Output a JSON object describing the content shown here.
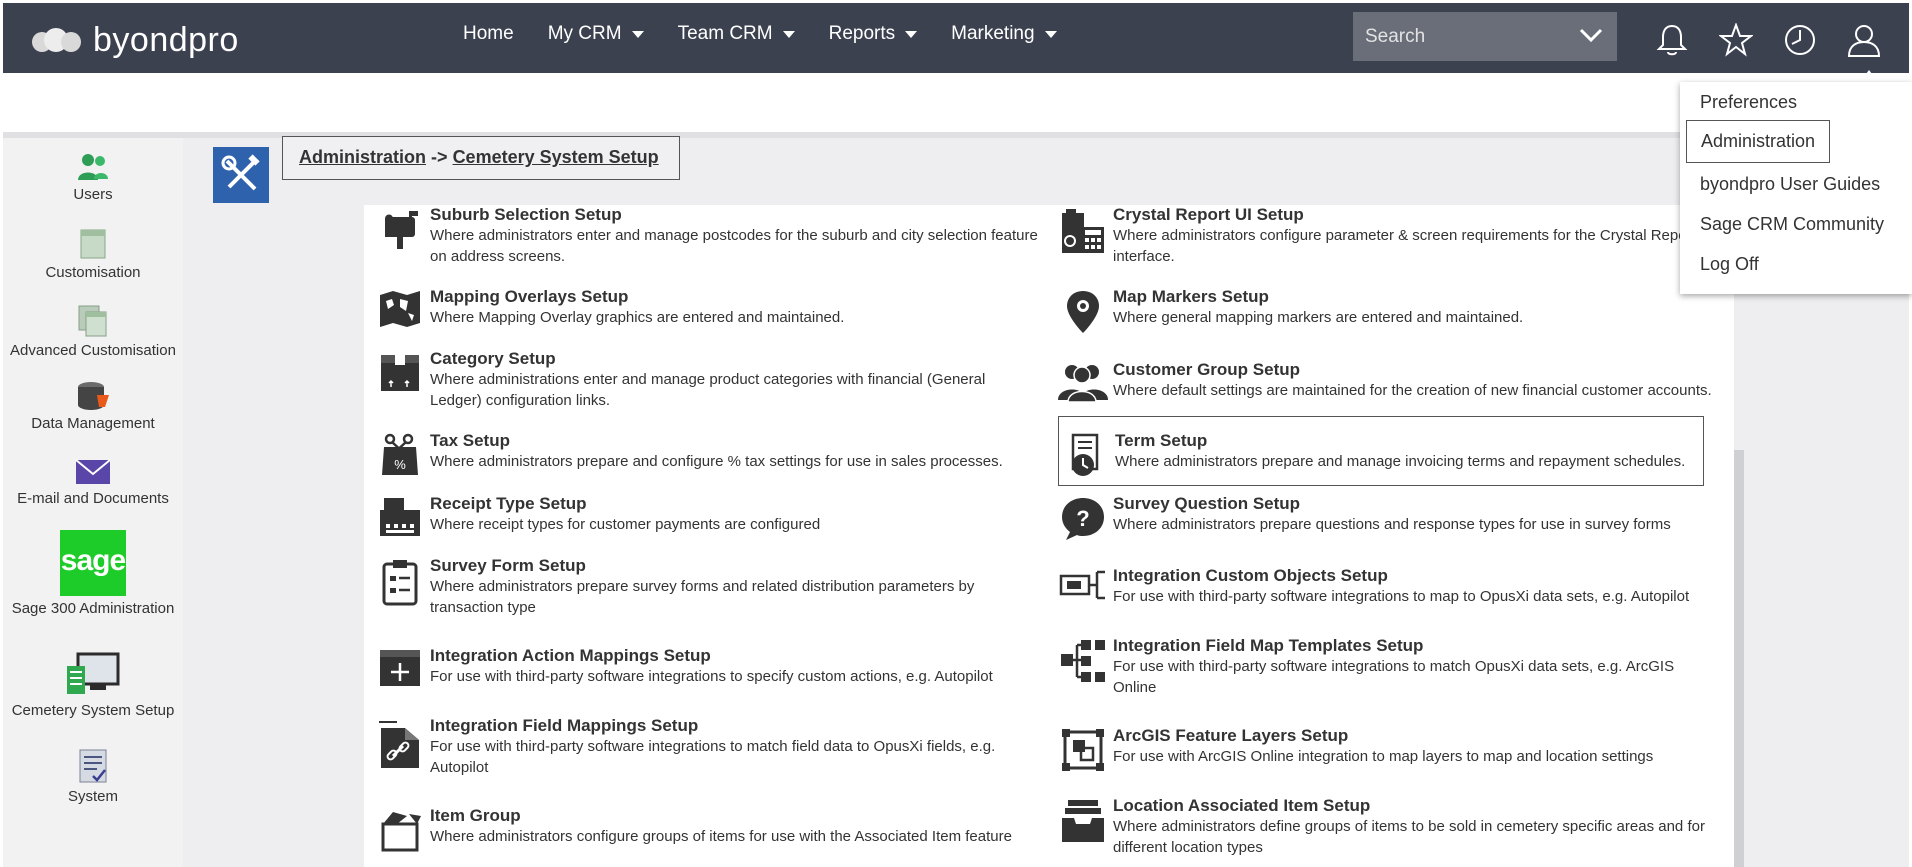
{
  "app": {
    "brand": "byondpro",
    "accent_color": "#2f62ad",
    "nav_bg": "#3c4150"
  },
  "nav": {
    "items": [
      {
        "label": "Home",
        "dropdown": false
      },
      {
        "label": "My CRM",
        "dropdown": true
      },
      {
        "label": "Team CRM",
        "dropdown": true
      },
      {
        "label": "Reports",
        "dropdown": true
      },
      {
        "label": "Marketing",
        "dropdown": true
      }
    ],
    "search_placeholder": "Search",
    "icons": [
      "bell-icon",
      "star-icon",
      "clock-icon",
      "user-icon"
    ]
  },
  "user_menu": {
    "items": [
      "Preferences",
      "Administration",
      "byondpro User Guides",
      "Sage CRM Community",
      "Log Off"
    ],
    "active": "Administration"
  },
  "sidebar": {
    "items": [
      {
        "label": "Users",
        "icon": "users-icon"
      },
      {
        "label": "Customisation",
        "icon": "customisation-icon"
      },
      {
        "label": "Advanced Customisation",
        "icon": "advanced-customisation-icon"
      },
      {
        "label": "Data Management",
        "icon": "database-icon"
      },
      {
        "label": "E-mail and Documents",
        "icon": "envelope-icon"
      },
      {
        "label": "Sage 300 Administration",
        "icon": "sage-logo-icon",
        "logo_text": "sage"
      },
      {
        "label": "Cemetery System Setup",
        "icon": "cemetery-setup-icon"
      },
      {
        "label": "System",
        "icon": "system-icon"
      }
    ]
  },
  "breadcrumb": {
    "root": "Administration",
    "separator": "->",
    "current": "Cemetery System Setup"
  },
  "entries_left": [
    {
      "title": "Suburb Selection Setup",
      "desc": [
        "Where administrators enter and manage postcodes for the suburb and city selection feature",
        "on address screens."
      ],
      "icon": "mailbox-icon"
    },
    {
      "title": "Mapping Overlays Setup",
      "desc": [
        "Where Mapping Overlay graphics are entered and maintained."
      ],
      "icon": "world-map-icon"
    },
    {
      "title": "Category Setup",
      "desc": [
        "Where administrations enter and manage product categories with financial (General",
        "Ledger) configuration links."
      ],
      "icon": "box-icon"
    },
    {
      "title": "Tax Setup",
      "desc": [
        "Where administrators prepare and configure % tax settings for use in sales processes."
      ],
      "icon": "tax-bag-icon"
    },
    {
      "title": "Receipt Type Setup",
      "desc": [
        "Where receipt types for customer payments are configured"
      ],
      "icon": "cash-register-icon"
    },
    {
      "title": "Survey Form Setup",
      "desc": [
        "Where administrators prepare survey forms and related distribution parameters by",
        "transaction type"
      ],
      "icon": "clipboard-icon"
    },
    {
      "title": "Integration Action Mappings Setup",
      "desc": [
        "For use with third-party software integrations to specify custom actions, e.g. Autopilot"
      ],
      "icon": "add-window-icon"
    },
    {
      "title": "Integration Field Mappings Setup",
      "desc": [
        "For use with third-party software integrations to match field data to OpusXi fields, e.g.",
        "Autopilot"
      ],
      "icon": "link-document-icon"
    },
    {
      "title": "Item Group",
      "desc": [
        "Where administrators configure groups of items for use with the Associated Item feature"
      ],
      "icon": "open-box-icon"
    }
  ],
  "entries_right": [
    {
      "title": "Crystal Report UI Setup",
      "desc": [
        "Where administrators configure parameter & screen requirements for the Crystal Report",
        "interface."
      ],
      "icon": "report-calculator-icon"
    },
    {
      "title": "Map Markers Setup",
      "desc": [
        "Where general mapping markers are entered and maintained."
      ],
      "icon": "map-marker-icon"
    },
    {
      "title": "Customer Group Setup",
      "desc": [
        "Where default settings are maintained for the creation of new financial customer accounts."
      ],
      "icon": "group-icon"
    },
    {
      "title": "Term Setup",
      "desc": [
        "Where administrators prepare and manage invoicing terms and repayment schedules."
      ],
      "icon": "clock-document-icon",
      "selected": true
    },
    {
      "title": "Survey Question Setup",
      "desc": [
        "Where administrators prepare questions and response types for use in survey forms"
      ],
      "icon": "question-bubble-icon"
    },
    {
      "title": "Integration Custom Objects Setup",
      "desc": [
        "For use with third-party software integrations to map to OpusXi data sets, e.g. Autopilot"
      ],
      "icon": "custom-object-icon"
    },
    {
      "title": "Integration Field Map Templates Setup",
      "desc": [
        "For use with third-party software integrations to match OpusXi data sets, e.g. ArcGIS",
        "Online"
      ],
      "icon": "hierarchy-icon"
    },
    {
      "title": "ArcGIS Feature Layers Setup",
      "desc": [
        "For use with ArcGIS Online integration to map layers to map and location settings"
      ],
      "icon": "layers-frame-icon"
    },
    {
      "title": "Location Associated Item Setup",
      "desc": [
        "Where administrators define groups of items to be sold in cemetery specific areas and for",
        "different location types"
      ],
      "icon": "archive-tray-icon"
    }
  ]
}
